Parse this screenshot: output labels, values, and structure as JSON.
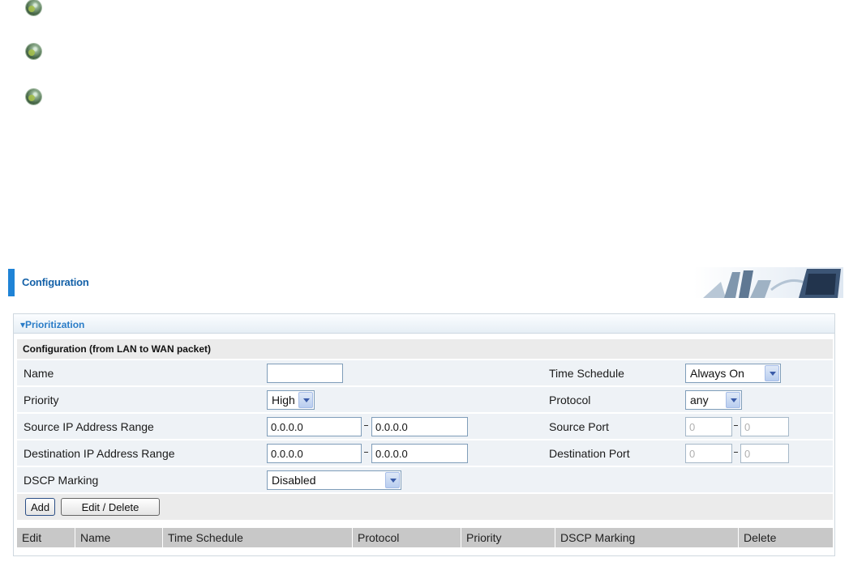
{
  "header": {
    "title": "Configuration"
  },
  "section": {
    "title": "Prioritization",
    "subtitle": "Configuration (from LAN to WAN packet)"
  },
  "form": {
    "name_label": "Name",
    "name_value": "",
    "time_schedule_label": "Time Schedule",
    "time_schedule_value": "Always On",
    "priority_label": "Priority",
    "priority_value": "High",
    "protocol_label": "Protocol",
    "protocol_value": "any",
    "src_ip_label": "Source IP Address Range",
    "src_ip_start": "0.0.0.0",
    "src_ip_end": "0.0.0.0",
    "src_port_label": "Source Port",
    "src_port_start": "0",
    "src_port_end": "0",
    "dst_ip_label": "Destination IP Address Range",
    "dst_ip_start": "0.0.0.0",
    "dst_ip_end": "0.0.0.0",
    "dst_port_label": "Destination Port",
    "dst_port_start": "0",
    "dst_port_end": "0",
    "dscp_label": "DSCP Marking",
    "dscp_value": "Disabled"
  },
  "buttons": {
    "add": "Add",
    "edit_delete": "Edit / Delete"
  },
  "table": {
    "columns": [
      "Edit",
      "Name",
      "Time Schedule",
      "Protocol",
      "Priority",
      "DSCP Marking",
      "Delete"
    ]
  },
  "colors": {
    "accent": "#1f83d6",
    "title_text": "#1461a8",
    "section_text": "#2a7cc7"
  },
  "icons": [
    "bullet-icon",
    "bullet-icon",
    "bullet-icon",
    "dropdown-arrow-icon"
  ]
}
